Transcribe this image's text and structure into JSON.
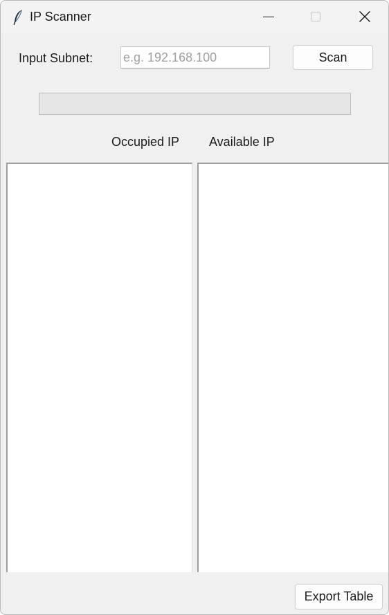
{
  "window": {
    "title": "IP Scanner",
    "icon": "feather-icon",
    "controls": [
      "minimize-icon",
      "maximize-icon",
      "close-icon"
    ]
  },
  "form": {
    "subnet_label": "Input Subnet:",
    "subnet_value": "",
    "subnet_placeholder": "e.g. 192.168.100",
    "scan_label": "Scan"
  },
  "progress": {
    "fraction": 0,
    "fill_color": "#06b025"
  },
  "columns": {
    "occupied_header": "Occupied IP",
    "available_header": "Available IP"
  },
  "lists": {
    "occupied": [],
    "available": []
  },
  "footer": {
    "export_label": "Export Table"
  }
}
